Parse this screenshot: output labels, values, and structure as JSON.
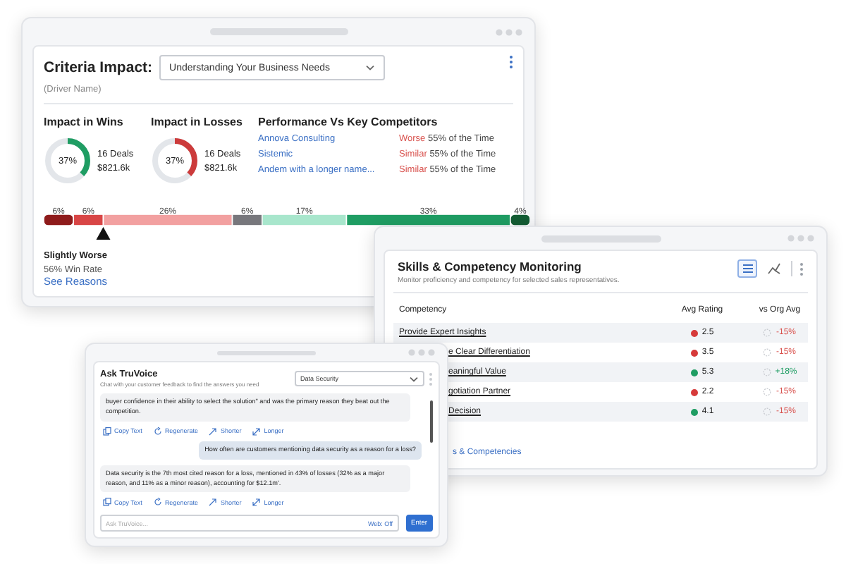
{
  "criteria_window": {
    "title": "Criteria Impact:",
    "dropdown": {
      "value": "Understanding Your Business Needs"
    },
    "subtitle": "(Driver Name)",
    "impacts": [
      {
        "heading": "Impact in Wins",
        "percent": "37%",
        "level": 0.37,
        "color": "#1f9d63",
        "deals": "16 Deals",
        "amount": "$821.6k"
      },
      {
        "heading": "Impact in Losses",
        "percent": "37%",
        "level": 0.37,
        "color": "#cc3b3b",
        "deals": "16 Deals",
        "amount": "$821.6k"
      }
    ],
    "competitors": {
      "heading": "Performance Vs Key Competitors",
      "rows": [
        {
          "name": "Annova Consulting",
          "status": "Worse",
          "share": "55% of the Time"
        },
        {
          "name": "Sistemic",
          "status": "Similar",
          "share": "55% of the Time"
        },
        {
          "name": "Andem with a longer name...",
          "status": "Similar",
          "share": "55% of the Time"
        }
      ]
    },
    "chart_data": {
      "type": "bar",
      "orientation": "horizontal",
      "stacked": true,
      "series": [
        {
          "color": "#8e1b1b",
          "values": [
            6
          ],
          "value_labels": [
            "6%"
          ]
        },
        {
          "color": "#d84545",
          "values": [
            6
          ],
          "value_labels": [
            "6%"
          ]
        },
        {
          "color": "#f2a0a0",
          "values": [
            26
          ],
          "value_labels": [
            "26%"
          ]
        },
        {
          "color": "#77777c",
          "values": [
            6
          ],
          "value_labels": [
            "6%"
          ]
        },
        {
          "color": "#a8e6cc",
          "values": [
            17
          ],
          "value_labels": [
            "17%"
          ]
        },
        {
          "color": "#1f9d63",
          "values": [
            33
          ],
          "value_labels": [
            "33%"
          ]
        },
        {
          "color": "#135c33",
          "values": [
            4
          ],
          "value_labels": [
            "4%"
          ]
        }
      ]
    },
    "marker": {
      "label": "Slightly Worse",
      "sublabel": "56% Win Rate"
    },
    "link": "See Reasons"
  },
  "skills_window": {
    "title": "Skills & Competency Monitoring",
    "subtitle": "Monitor proficiency and competency for selected sales representatives.",
    "views": [
      {
        "kind": "list",
        "selected": true
      },
      {
        "kind": "chart",
        "selected": false
      }
    ],
    "columns": [
      "Competency",
      "Avg Rating",
      "vs Org Avg"
    ],
    "rows": [
      {
        "competency": "Provide Expert Insights",
        "clipped": false,
        "color": "#d63a3a",
        "rating": "2.5",
        "positive": false,
        "change": "-15%"
      },
      {
        "competency": "e Clear Differentiation",
        "clipped": true,
        "color": "#d63a3a",
        "rating": "3.5",
        "positive": false,
        "change": "-15%"
      },
      {
        "competency": "eaningful Value",
        "clipped": true,
        "color": "#1f9d63",
        "rating": "5.3",
        "positive": true,
        "change": "+18%"
      },
      {
        "competency": "gotiation Partner",
        "clipped": true,
        "color": "#d63a3a",
        "rating": "2.2",
        "positive": false,
        "change": "-15%"
      },
      {
        "competency": "Decision",
        "clipped": true,
        "color": "#1f9d63",
        "rating": "4.1",
        "positive": false,
        "change": "-15%"
      }
    ],
    "footer_link": "s & Competencies"
  },
  "chat_window": {
    "title": "Ask TruVoice",
    "subtitle": "Chat with your customer feedback to find the answers you need",
    "topic": {
      "value": "Data Security"
    },
    "messages": [
      {
        "kind": "answer",
        "text": "buyer confidence in their ability to select the solution\" and was the primary reason they beat out the competition.",
        "actions": [
          {
            "kind": "copy",
            "label": "Copy Text"
          },
          {
            "kind": "regenerate",
            "label": "Regenerate"
          },
          {
            "kind": "shorter",
            "label": "Shorter"
          },
          {
            "kind": "longer",
            "label": "Longer"
          }
        ]
      },
      {
        "kind": "question",
        "text": "How often are customers mentioning data security as a reason for a loss?"
      },
      {
        "kind": "answer",
        "text": "Data security is the 7th most cited reason for a loss, mentioned in 43% of losses (32% as a major reason, and 11% as a minor reason), accounting for $12.1m'.",
        "actions": [
          {
            "kind": "copy",
            "label": "Copy Text"
          },
          {
            "kind": "regenerate",
            "label": "Regenerate"
          },
          {
            "kind": "shorter",
            "label": "Shorter"
          },
          {
            "kind": "longer",
            "label": "Longer"
          }
        ]
      }
    ],
    "input": {
      "placeholder": "Ask TruVoice...",
      "toggle": "Web: Off"
    },
    "submit": "Enter"
  }
}
